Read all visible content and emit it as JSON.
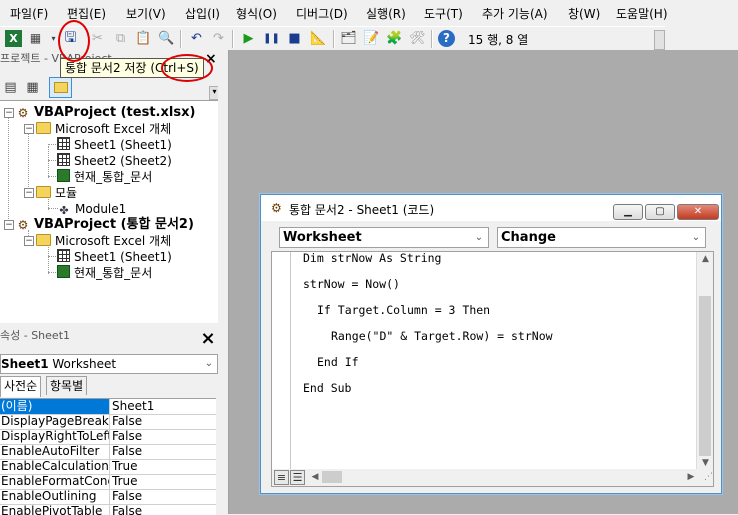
{
  "menu": [
    "파일(F)",
    "편집(E)",
    "보기(V)",
    "삽입(I)",
    "형식(O)",
    "디버그(D)",
    "실행(R)",
    "도구(T)",
    "추가 기능(A)",
    "창(W)",
    "도움말(H)"
  ],
  "toolbar": {
    "cursor_position": "15 행, 8 열",
    "icons": [
      "excel-view-icon",
      "insert-userform-icon",
      "save-icon",
      "cut-icon",
      "copy-icon",
      "paste-icon",
      "find-icon",
      "undo-icon",
      "redo-icon",
      "run-icon",
      "break-icon",
      "reset-icon",
      "design-mode-icon",
      "project-explorer-icon",
      "properties-icon",
      "object-browser-icon",
      "toolbox-icon",
      "help-icon"
    ]
  },
  "tooltip": {
    "label": "통합 문서2 저장",
    "shortcut": "(Ctrl+S)"
  },
  "project_explorer": {
    "title": "프로젝트 - VBAProject",
    "tree": [
      {
        "label": "VBAProject (test.xlsx)",
        "icon": "vba-project-icon",
        "level": 0,
        "bold": true
      },
      {
        "label": "Microsoft Excel 개체",
        "icon": "folder-icon",
        "level": 1
      },
      {
        "label": "Sheet1 (Sheet1)",
        "icon": "worksheet-icon",
        "level": 2
      },
      {
        "label": "Sheet2 (Sheet2)",
        "icon": "worksheet-icon",
        "level": 2
      },
      {
        "label": "현재_통합_문서",
        "icon": "workbook-icon",
        "level": 2
      },
      {
        "label": "모듈",
        "icon": "folder-icon",
        "level": 1
      },
      {
        "label": "Module1",
        "icon": "module-icon",
        "level": 2
      },
      {
        "label": "VBAProject (통합 문서2)",
        "icon": "vba-project-icon",
        "level": 0,
        "bold": true
      },
      {
        "label": "Microsoft Excel 개체",
        "icon": "folder-icon",
        "level": 1
      },
      {
        "label": "Sheet1 (Sheet1)",
        "icon": "worksheet-icon",
        "level": 2
      },
      {
        "label": "현재_통합_문서",
        "icon": "workbook-icon",
        "level": 2
      }
    ]
  },
  "properties": {
    "title": "속성 - Sheet1",
    "object_name": "Sheet1",
    "object_type": "Worksheet",
    "tabs": [
      "사전순",
      "항목별"
    ],
    "rows": [
      {
        "name": "(이름)",
        "value": "Sheet1"
      },
      {
        "name": "DisplayPageBreaks",
        "value": "False"
      },
      {
        "name": "DisplayRightToLeft",
        "value": "False"
      },
      {
        "name": "EnableAutoFilter",
        "value": "False"
      },
      {
        "name": "EnableCalculation",
        "value": "True"
      },
      {
        "name": "EnableFormatConditionsCalculation",
        "value": "True"
      },
      {
        "name": "EnableOutlining",
        "value": "False"
      },
      {
        "name": "EnablePivotTable",
        "value": "False"
      }
    ]
  },
  "code_window": {
    "title": "통합 문서2 - Sheet1 (코드)",
    "object_combo": "Worksheet",
    "procedure_combo": "Change",
    "lines": [
      {
        "text": "Dim strNow As String",
        "indent": 0
      },
      {
        "text": "",
        "indent": 0
      },
      {
        "text": "strNow = Now()",
        "indent": 0
      },
      {
        "text": "",
        "indent": 0
      },
      {
        "text": "If Target.Column = 3 Then",
        "indent": 1
      },
      {
        "text": "",
        "indent": 0
      },
      {
        "text": "Range(\"D\" & Target.Row) = strNow",
        "indent": 2
      },
      {
        "text": "",
        "indent": 0
      },
      {
        "text": "End If",
        "indent": 1
      },
      {
        "text": "",
        "indent": 0
      },
      {
        "text": "End Sub",
        "indent": 0
      }
    ]
  },
  "colors": {
    "selection": "#0078d7",
    "annotation": "#e00000",
    "workspace": "#ababab",
    "tooltip_bg": "#ffffe1"
  }
}
